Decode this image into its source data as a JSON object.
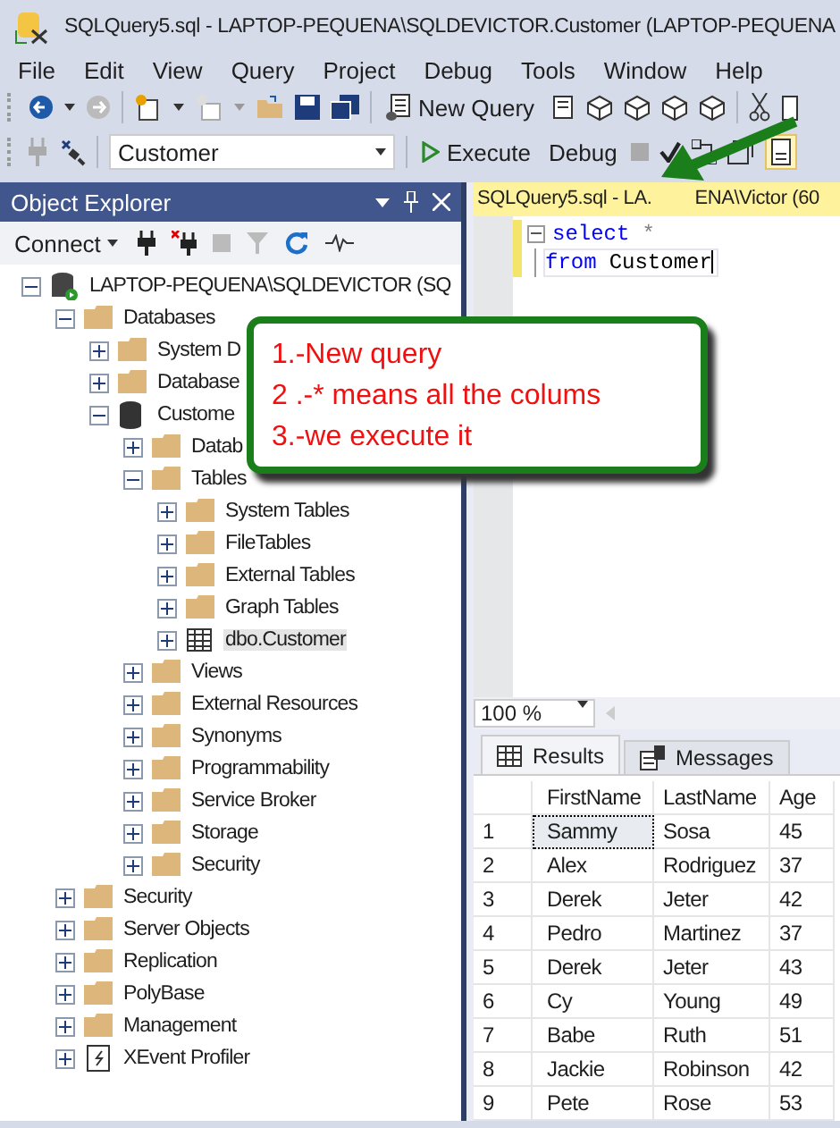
{
  "window": {
    "title": "SQLQuery5.sql - LAPTOP-PEQUENA\\SQLDEVICTOR.Customer (LAPTOP-PEQUENA"
  },
  "menu": [
    "File",
    "Edit",
    "View",
    "Query",
    "Project",
    "Debug",
    "Tools",
    "Window",
    "Help"
  ],
  "toolbar": {
    "new_query": "New Query"
  },
  "query_toolbar": {
    "database": "Customer",
    "execute": "Execute",
    "debug": "Debug",
    "results_to_grid_on": true
  },
  "object_explorer": {
    "title": "Object Explorer",
    "connect": "Connect",
    "tree": [
      {
        "label": "LAPTOP-PEQUENA\\SQLDEVICTOR (SQ",
        "kind": "server",
        "expanded": true,
        "selected": false,
        "children": [
          {
            "label": "Databases",
            "kind": "folder",
            "expanded": true,
            "selected": false,
            "children": [
              {
                "label": "System D",
                "kind": "folder",
                "expanded": false,
                "selected": false
              },
              {
                "label": "Database",
                "kind": "folder",
                "expanded": false,
                "selected": false
              },
              {
                "label": "Custome",
                "kind": "database",
                "expanded": true,
                "selected": false,
                "children": [
                  {
                    "label": "Datab",
                    "kind": "folder",
                    "expanded": false,
                    "selected": false
                  },
                  {
                    "label": "Tables",
                    "kind": "folder",
                    "expanded": true,
                    "selected": false,
                    "children": [
                      {
                        "label": "System Tables",
                        "kind": "folder",
                        "expanded": false,
                        "selected": false
                      },
                      {
                        "label": "FileTables",
                        "kind": "folder",
                        "expanded": false,
                        "selected": false
                      },
                      {
                        "label": "External Tables",
                        "kind": "folder",
                        "expanded": false,
                        "selected": false
                      },
                      {
                        "label": "Graph Tables",
                        "kind": "folder",
                        "expanded": false,
                        "selected": false
                      },
                      {
                        "label": "dbo.Customer",
                        "kind": "table",
                        "expanded": false,
                        "selected": true
                      }
                    ]
                  },
                  {
                    "label": "Views",
                    "kind": "folder",
                    "expanded": false,
                    "selected": false
                  },
                  {
                    "label": "External Resources",
                    "kind": "folder",
                    "expanded": false,
                    "selected": false
                  },
                  {
                    "label": "Synonyms",
                    "kind": "folder",
                    "expanded": false,
                    "selected": false
                  },
                  {
                    "label": "Programmability",
                    "kind": "folder",
                    "expanded": false,
                    "selected": false
                  },
                  {
                    "label": "Service Broker",
                    "kind": "folder",
                    "expanded": false,
                    "selected": false
                  },
                  {
                    "label": "Storage",
                    "kind": "folder",
                    "expanded": false,
                    "selected": false
                  },
                  {
                    "label": "Security",
                    "kind": "folder",
                    "expanded": false,
                    "selected": false
                  }
                ]
              }
            ]
          },
          {
            "label": "Security",
            "kind": "folder",
            "expanded": false,
            "selected": false
          },
          {
            "label": "Server Objects",
            "kind": "folder",
            "expanded": false,
            "selected": false
          },
          {
            "label": "Replication",
            "kind": "folder",
            "expanded": false,
            "selected": false
          },
          {
            "label": "PolyBase",
            "kind": "folder",
            "expanded": false,
            "selected": false
          },
          {
            "label": "Management",
            "kind": "folder",
            "expanded": false,
            "selected": false
          },
          {
            "label": "XEvent Profiler",
            "kind": "xevent",
            "expanded": false,
            "selected": false
          }
        ]
      }
    ]
  },
  "editor": {
    "tab_title_parts": [
      "SQLQuery5.sql - LA.",
      "ENA\\Victor (60"
    ],
    "lines": [
      {
        "fold": true,
        "tokens": [
          {
            "kind": "keyword",
            "text": "select"
          },
          {
            "kind": "operator",
            "text": "*"
          }
        ]
      },
      {
        "fold": false,
        "tokens": [
          {
            "kind": "keyword",
            "text": "from"
          },
          {
            "kind": "identifier",
            "text": "Customer"
          }
        ]
      }
    ]
  },
  "zoom": "100 %",
  "results_tabs": [
    {
      "label": "Results",
      "kind": "grid",
      "selected": true
    },
    {
      "label": "Messages",
      "kind": "messages",
      "selected": false
    }
  ],
  "results": {
    "columns": [
      "FirstName",
      "LastName",
      "Age"
    ],
    "rows": [
      {
        "number": "1",
        "cells": [
          "Sammy",
          "Sosa",
          "45"
        ],
        "selected": true
      },
      {
        "number": "2",
        "cells": [
          "Alex",
          "Rodriguez",
          "37"
        ],
        "selected": false
      },
      {
        "number": "3",
        "cells": [
          "Derek",
          "Jeter",
          "42"
        ],
        "selected": false
      },
      {
        "number": "4",
        "cells": [
          "Pedro",
          "Martinez",
          "37"
        ],
        "selected": false
      },
      {
        "number": "5",
        "cells": [
          "Derek",
          "Jeter",
          "43"
        ],
        "selected": false
      },
      {
        "number": "6",
        "cells": [
          "Cy",
          "Young",
          "49"
        ],
        "selected": false
      },
      {
        "number": "7",
        "cells": [
          "Babe",
          "Ruth",
          "51"
        ],
        "selected": false
      },
      {
        "number": "8",
        "cells": [
          "Jackie",
          "Robinson",
          "42"
        ],
        "selected": false
      },
      {
        "number": "9",
        "cells": [
          "Pete",
          "Rose",
          "53"
        ],
        "selected": false
      }
    ]
  },
  "callout": {
    "lines": [
      "1.-New query",
      "2 .-* means all the colums",
      "3.-we execute it"
    ]
  }
}
